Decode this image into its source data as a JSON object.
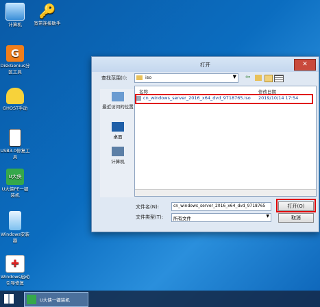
{
  "desktop": {
    "icons": [
      {
        "label": "计算机",
        "icon": "computer-icon"
      },
      {
        "label": "宽带连接助手",
        "icon": "key-icon"
      },
      {
        "label": "DiskGenius分区工具",
        "icon": "diskgenius-icon"
      },
      {
        "label": "GHOST手动",
        "icon": "ghost-icon"
      },
      {
        "label": "USB3.0修复工具",
        "icon": "usb-icon"
      },
      {
        "label": "U大侠PE一键装机",
        "icon": "udaxia-icon"
      },
      {
        "label": "Windows安装器",
        "icon": "windows-installer-icon"
      },
      {
        "label": "Windows启动引导修复",
        "icon": "toolbox-icon"
      }
    ]
  },
  "dialog": {
    "title": "打开",
    "close": "✕",
    "look_in_label": "查找范围(I):",
    "look_in_value": "iso",
    "places": [
      {
        "label": "最近访问的位置",
        "icon": "recent-icon"
      },
      {
        "label": "桌面",
        "icon": "desktop-icon"
      },
      {
        "label": "计算机",
        "icon": "computer-icon"
      }
    ],
    "columns": {
      "name": "名称",
      "modified": "修改日期"
    },
    "files": [
      {
        "name": "cn_windows_server_2016_x64_dvd_9718765.iso",
        "modified": "2019/10/14 17:54"
      }
    ],
    "filename_label": "文件名(N):",
    "filename_value": "cn_windows_server_2016_x64_dvd_9718765",
    "filetype_label": "文件类型(T):",
    "filetype_value": "所有文件",
    "open_button": "打开(O)",
    "cancel_button": "取消"
  },
  "taskbar": {
    "task_label": "U大侠一键装机"
  },
  "colors": {
    "highlight": "#e00000",
    "accent": "#0b6dc0"
  }
}
